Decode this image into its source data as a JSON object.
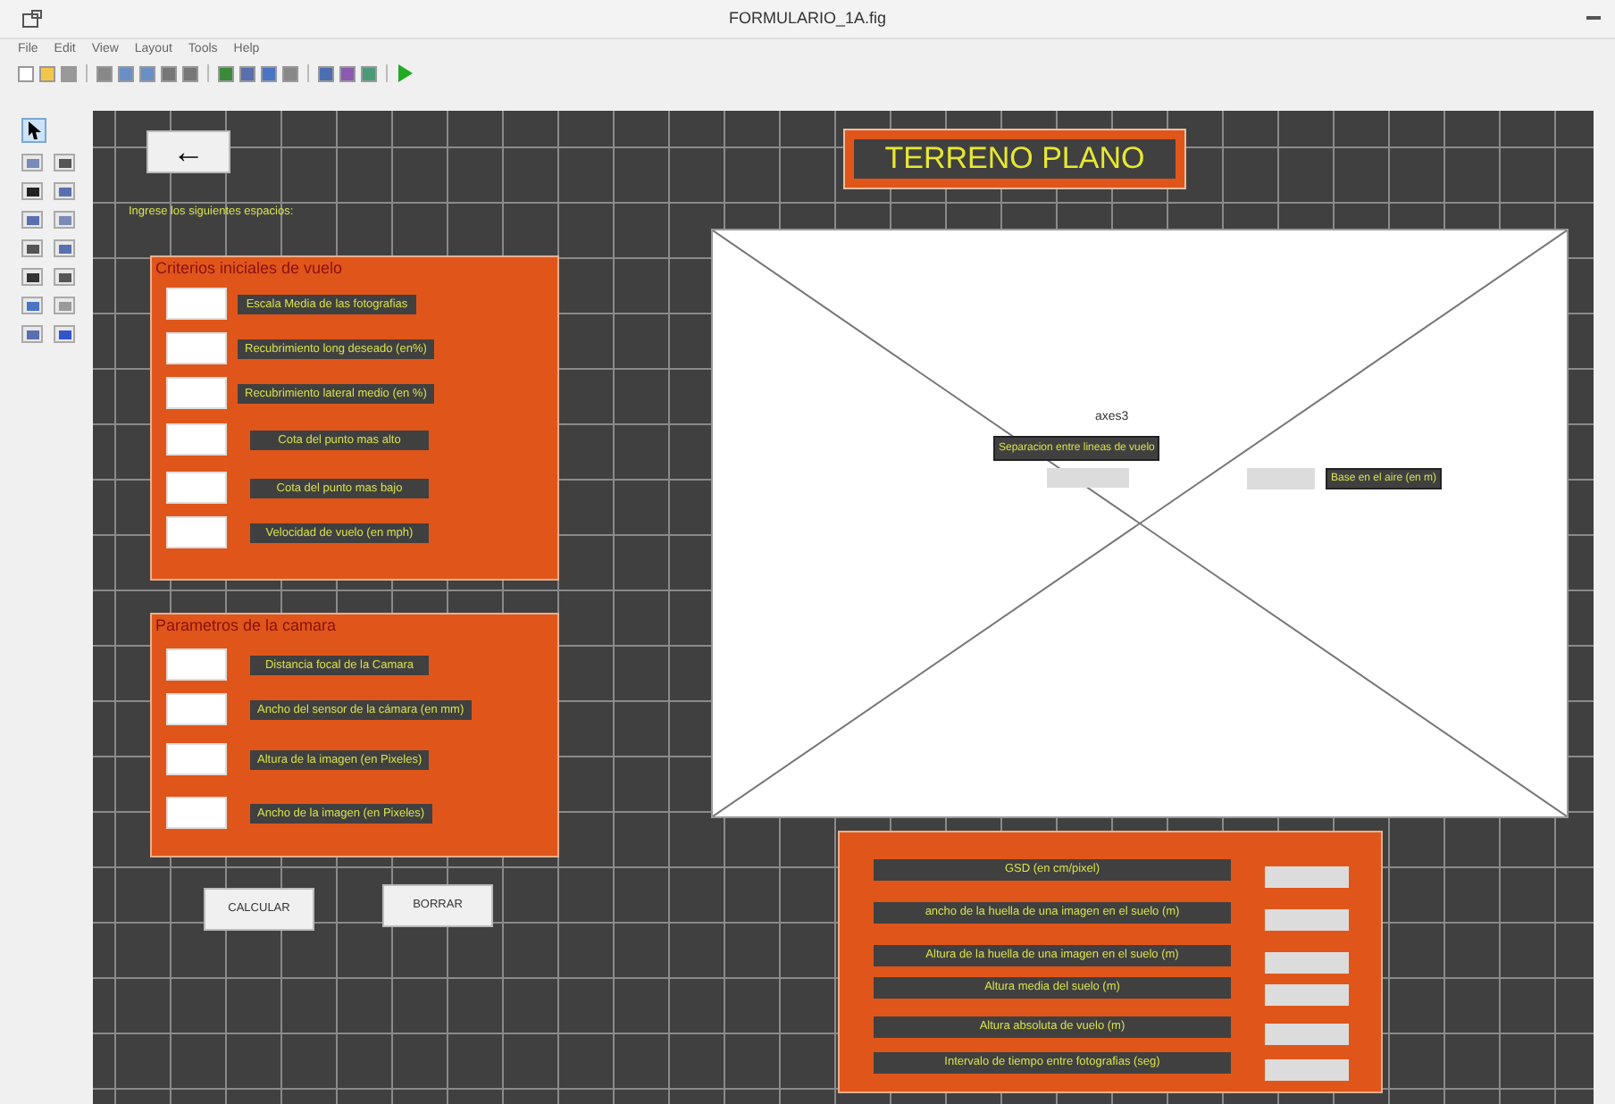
{
  "window": {
    "title": "FORMULARIO_1A.fig"
  },
  "menu": [
    "File",
    "Edit",
    "View",
    "Layout",
    "Tools",
    "Help"
  ],
  "canvas": {
    "back_button": {
      "label": "←"
    },
    "instruction": "Ingrese los siguientes espacios:",
    "title": "TERRENO PLANO",
    "panels": [
      {
        "title": "Criterios iniciales de vuelo",
        "rows": [
          "Escala Media de las fotografias",
          "Recubrimiento long deseado (en%)",
          "Recubrimiento lateral medio  (en %)",
          "Cota del punto mas alto",
          "Cota del punto mas bajo",
          "Velocidad de vuelo (en mph)"
        ]
      },
      {
        "title": "Parametros de la camara",
        "rows": [
          "Distancia focal de la Camara",
          "Ancho del sensor de la cámara (en mm)",
          "Altura de la imagen (en Pixeles)",
          "Ancho de la imagen (en Pixeles)"
        ]
      }
    ],
    "buttons": [
      "CALCULAR",
      "BORRAR"
    ],
    "axes": {
      "label": "axes3"
    },
    "axes_outputs": [
      "Separacion entre lineas de vuelo",
      "Base en el aire (en m)"
    ],
    "results": [
      "GSD (en cm/pixel)",
      "ancho de la huella de una imagen en el suelo (m)",
      "Altura de la huella de una imagen en el suelo (m)",
      "Altura media del suelo (m)",
      "Altura absoluta de vuelo (m)",
      "Intervalo de tiempo entre fotografias (seg)"
    ]
  }
}
